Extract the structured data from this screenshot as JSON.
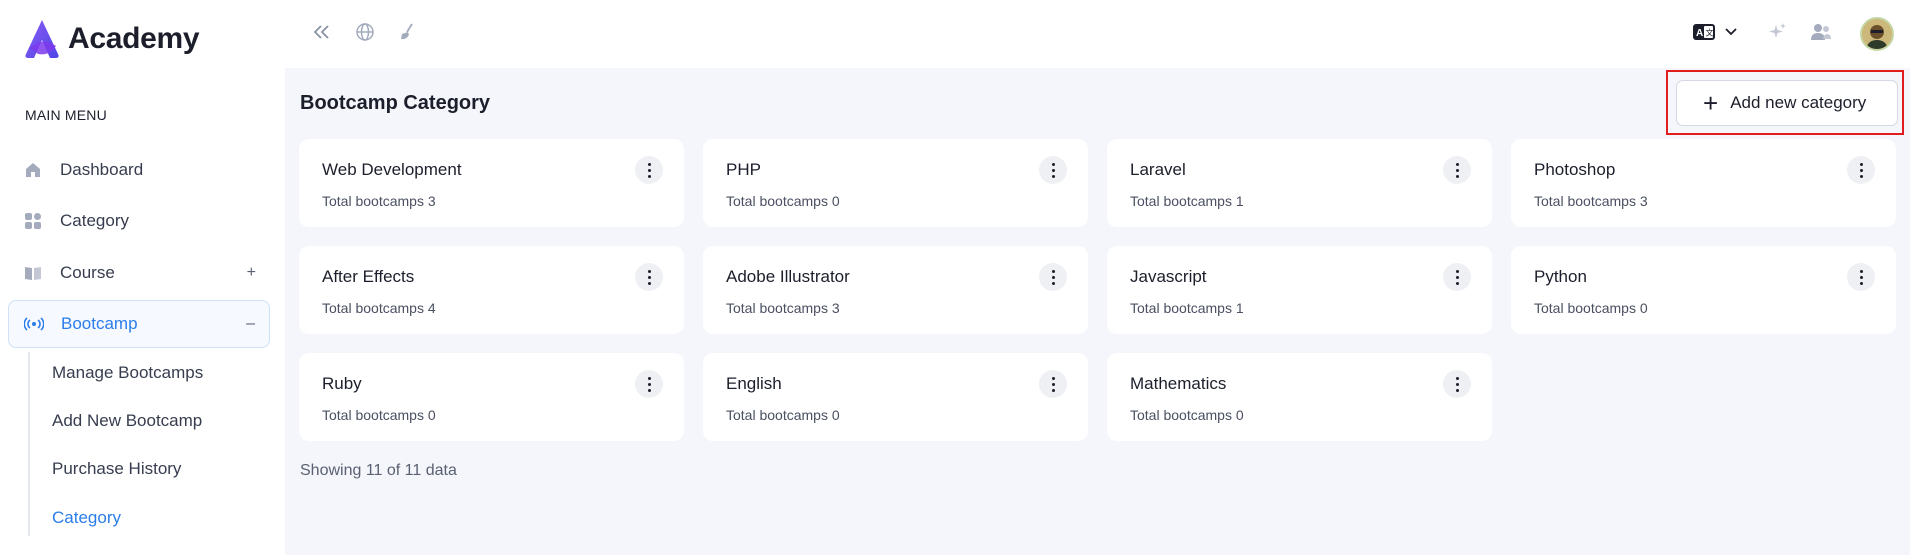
{
  "app": {
    "name": "Academy"
  },
  "sidebar": {
    "heading": "MAIN MENU",
    "items": [
      {
        "label": "Dashboard",
        "icon": "home-icon"
      },
      {
        "label": "Category",
        "icon": "category-grid-icon"
      },
      {
        "label": "Course",
        "icon": "book-icon",
        "toggle": "+"
      },
      {
        "label": "Bootcamp",
        "icon": "broadcast-icon",
        "toggle": "–"
      }
    ],
    "submenu": [
      {
        "label": "Manage Bootcamps"
      },
      {
        "label": "Add New Bootcamp"
      },
      {
        "label": "Purchase History"
      },
      {
        "label": "Category"
      }
    ]
  },
  "header": {
    "icons": [
      "collapse-sidebar-icon",
      "globe-icon",
      "clear-cache-icon",
      "language-icon",
      "chevron-down-icon",
      "sparkle-icon",
      "users-icon",
      "avatar"
    ]
  },
  "main": {
    "title": "Bootcamp Category",
    "add_button_label": "Add new category",
    "cards": [
      {
        "title": "Web Development",
        "subtitle": "Total bootcamps 3"
      },
      {
        "title": "PHP",
        "subtitle": "Total bootcamps 0"
      },
      {
        "title": "Laravel",
        "subtitle": "Total bootcamps 1"
      },
      {
        "title": "Photoshop",
        "subtitle": "Total bootcamps 3"
      },
      {
        "title": "After Effects",
        "subtitle": "Total bootcamps 4"
      },
      {
        "title": "Adobe Illustrator",
        "subtitle": "Total bootcamps 3"
      },
      {
        "title": "Javascript",
        "subtitle": "Total bootcamps 1"
      },
      {
        "title": "Python",
        "subtitle": "Total bootcamps 0"
      },
      {
        "title": "Ruby",
        "subtitle": "Total bootcamps 0"
      },
      {
        "title": "English",
        "subtitle": "Total bootcamps 0"
      },
      {
        "title": "Mathematics",
        "subtitle": "Total bootcamps 0"
      }
    ],
    "showing": "Showing 11 of 11 data"
  },
  "colors": {
    "accent": "#2b7de9",
    "highlight_frame": "#e11d1d",
    "brand": "#6c4ce6"
  }
}
